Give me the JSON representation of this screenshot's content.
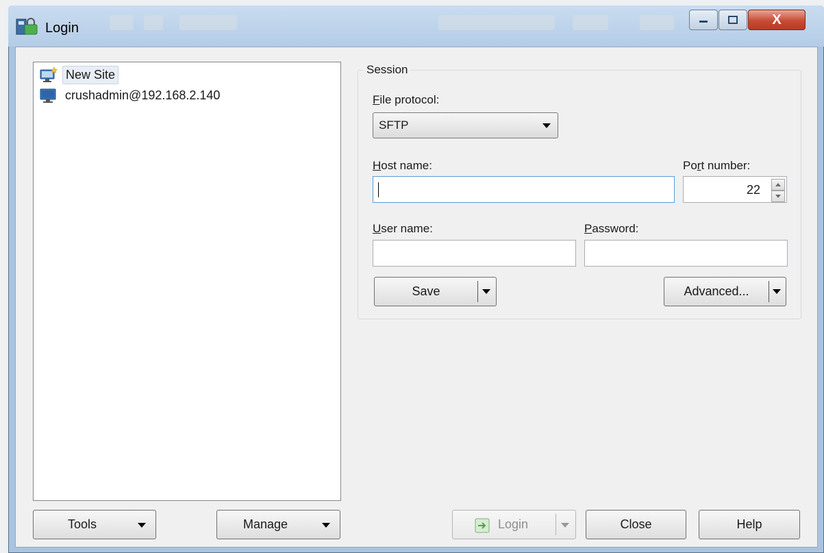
{
  "window": {
    "title": "Login",
    "close_glyph": "X"
  },
  "sites": [
    {
      "label": "New Site",
      "icon": "new-site-icon"
    },
    {
      "label": "crushadmin@192.168.2.140",
      "icon": "computer-icon"
    }
  ],
  "session": {
    "group_label": "Session",
    "protocol_label_key": "F",
    "protocol_label_rest": "ile protocol:",
    "protocol_value": "SFTP",
    "host_label_key": "H",
    "host_label_rest": "ost name:",
    "host_value": "",
    "port_label_pre": "Po",
    "port_label_key": "r",
    "port_label_rest": "t number:",
    "port_value": "22",
    "user_label_key": "U",
    "user_label_rest": "ser name:",
    "user_value": "",
    "password_label_key": "P",
    "password_label_rest": "assword:",
    "password_value": "",
    "save_label": "Save",
    "advanced_label": "Advanced..."
  },
  "footer": {
    "tools_label": "Tools",
    "manage_label": "Manage",
    "login_label": "Login",
    "close_label": "Close",
    "help_label": "Help"
  },
  "colors": {
    "title_bar": "#b4cce6",
    "client_bg": "#f0f0f0",
    "close_button": "#c84b34",
    "focus_border": "#5b9bd5"
  }
}
